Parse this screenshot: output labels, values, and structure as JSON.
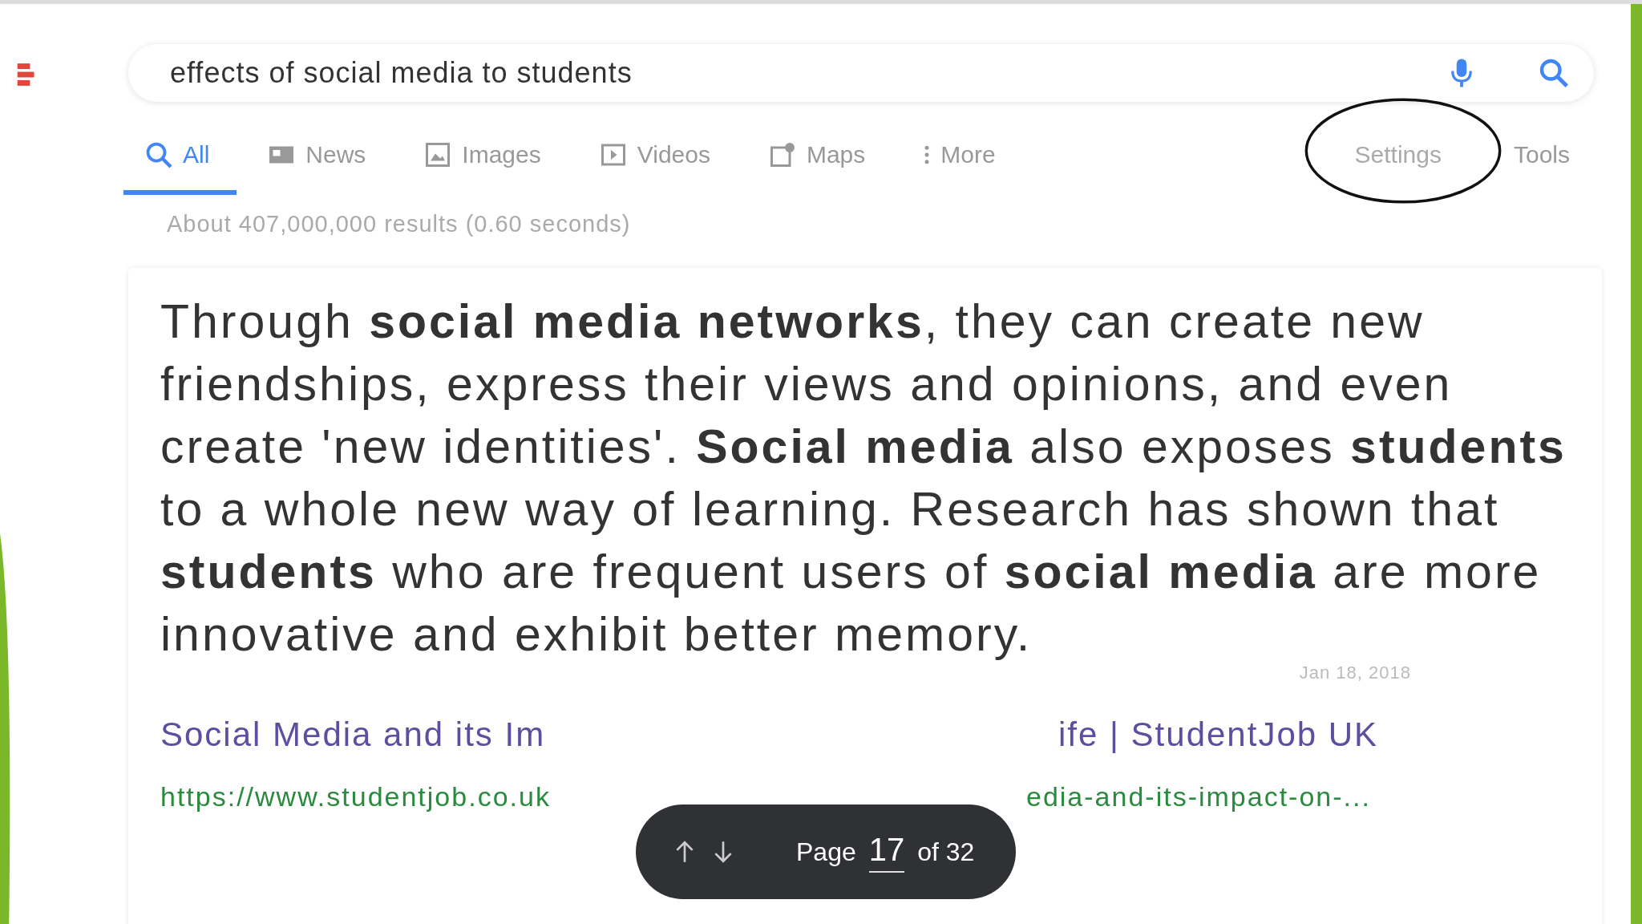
{
  "search": {
    "query": "effects of social media to students"
  },
  "tabs": [
    {
      "label": "All",
      "selected": true
    },
    {
      "label": "News",
      "selected": false
    },
    {
      "label": "Images",
      "selected": false
    },
    {
      "label": "Videos",
      "selected": false
    },
    {
      "label": "Maps",
      "selected": false
    },
    {
      "label": "More",
      "selected": false
    }
  ],
  "settings": "Settings",
  "tools": "Tools",
  "result_stats": "About 407,000,000 results (0.60 seconds)",
  "snippet": {
    "text": "Through **social media networks**, they can create new friendships, express their views and opinions, and even create 'new identities'. **Social media** also exposes **students** to a whole new way of learning. Research has shown that **students** who are frequent users of **social media** are more innovative and exhibit better memory.",
    "date": "Jan 18, 2018"
  },
  "result": {
    "title_parts": [
      "Social Media and its Im",
      "ife | StudentJob UK"
    ],
    "url_parts": [
      "https://www.studentjob.co.uk",
      "edia-and-its-impact-on-..."
    ]
  },
  "pager": {
    "label": "Page",
    "current": "17",
    "total": "of 32"
  }
}
